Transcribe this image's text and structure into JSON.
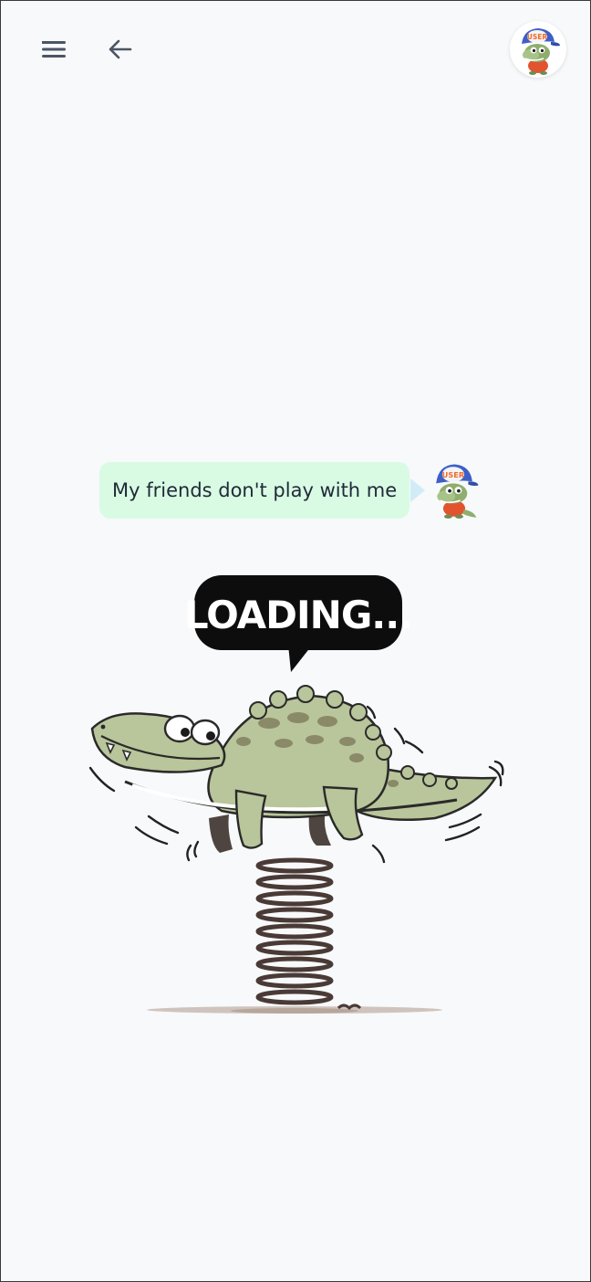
{
  "header": {
    "menu_icon": "menu-icon",
    "back_icon": "arrow-left-icon",
    "avatar_icon": "crocodile-user-avatar",
    "avatar_cap_text": "USER"
  },
  "chat": {
    "messages": [
      {
        "role": "user",
        "text": "My friends don't play with me",
        "avatar_icon": "crocodile-user-avatar",
        "avatar_cap_text": "USER"
      }
    ]
  },
  "loading": {
    "text": "LOADING...",
    "illustration_icon": "crocodile-on-spring-icon"
  },
  "colors": {
    "background": "#f7f9fb",
    "bubble": "#d9fbe4",
    "icon": "#4b5563",
    "cap": "#3d5fc8",
    "croc": "#b9c59a"
  }
}
